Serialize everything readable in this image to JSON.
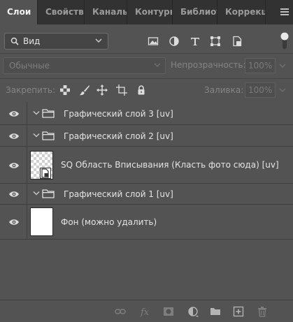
{
  "tabs": [
    {
      "label": "Слои",
      "active": true
    },
    {
      "label": "Свойства",
      "active": false
    },
    {
      "label": "Каналы",
      "active": false
    },
    {
      "label": "Контуры",
      "active": false
    },
    {
      "label": "Библиотеки",
      "active": false
    },
    {
      "label": "Коррекция",
      "active": false
    }
  ],
  "filter": {
    "kind_value": "Вид",
    "icons": [
      "image-filter-icon",
      "adjustment-filter-icon",
      "type-filter-icon",
      "shape-filter-icon",
      "smart-object-filter-icon"
    ]
  },
  "blend": {
    "mode": "Обычные",
    "opacity_label": "Непрозрачность:",
    "opacity_value": "100%"
  },
  "lock": {
    "label": "Закрепить:",
    "fill_label": "Заливка:",
    "fill_value": "100%"
  },
  "layers": [
    {
      "name": "Графический слой 3 [uv]",
      "type": "group",
      "visible": true
    },
    {
      "name": "Графический слой 2 [uv]",
      "type": "group",
      "visible": true
    },
    {
      "name": "SQ Область Вписывания (Класть фото сюда) [uv]",
      "type": "smart-object",
      "visible": true
    },
    {
      "name": "Графический слой 1 [uv]",
      "type": "group",
      "visible": true
    },
    {
      "name": "Фон (можно удалить)",
      "type": "background",
      "visible": true
    }
  ],
  "colors": {
    "panel": "#535353",
    "tabbar": "#323232",
    "text": "#e4e4e4"
  }
}
